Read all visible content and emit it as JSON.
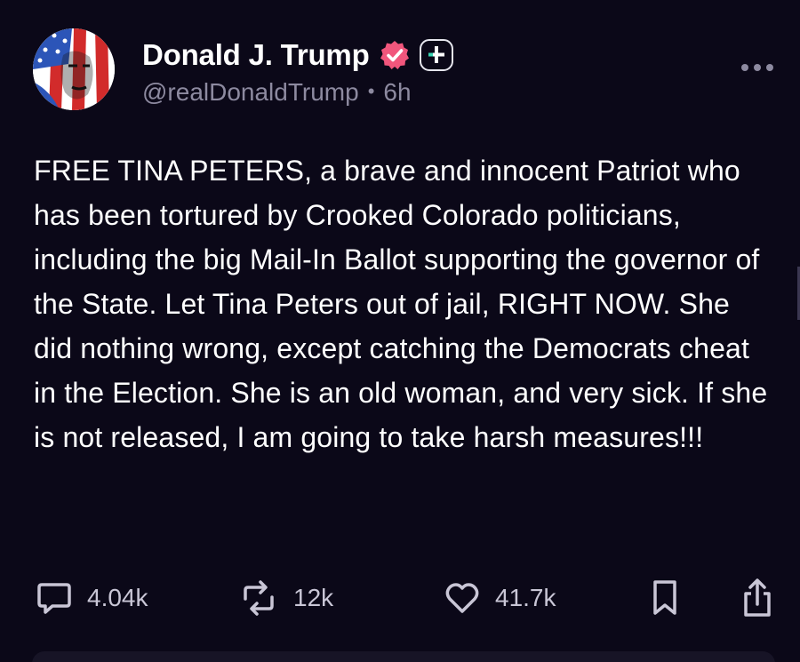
{
  "post": {
    "author": {
      "display_name": "Donald J. Trump",
      "handle": "@realDonaldTrump",
      "separator": "•",
      "time": "6h",
      "verified_icon": "verified-badge-icon",
      "verified_color": "#f1567c",
      "extra_badge_icon": "plus-badge-icon"
    },
    "text": "FREE TINA PETERS, a brave and innocent Patriot who has been tortured by Crooked Colorado politicians, including the big Mail-In Ballot supporting the governor of the State. Let Tina Peters out of jail, RIGHT NOW. She did nothing wrong, except catching the Democrats cheat in the Election. She is an old woman, and very sick. If she is not released, I am going to take harsh measures!!!",
    "actions": {
      "reply": {
        "icon": "reply-icon",
        "count": "4.04k"
      },
      "repost": {
        "icon": "repost-icon",
        "count": "12k"
      },
      "like": {
        "icon": "heart-icon",
        "count": "41.7k"
      },
      "bookmark": {
        "icon": "bookmark-icon"
      },
      "share": {
        "icon": "share-icon"
      }
    },
    "more_icon": "more-icon"
  },
  "colors": {
    "background": "#0b0818",
    "text_primary": "#ffffff",
    "text_secondary": "#8d8aa0",
    "plus_accent": "#3ad6b3"
  }
}
